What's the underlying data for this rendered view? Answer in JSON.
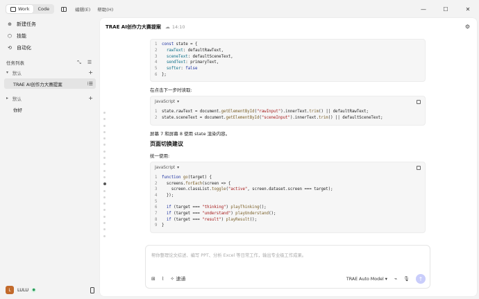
{
  "titlebar": {
    "modes": [
      {
        "label": "Work",
        "active": true
      },
      {
        "label": "Code",
        "active": false
      }
    ],
    "menu": [
      "编辑(E)",
      "帮助(H)"
    ],
    "window_controls": [
      "minimize-icon",
      "maximize-icon",
      "close-icon"
    ]
  },
  "sidebar": {
    "nav": [
      {
        "label": "新建任务",
        "icon": "new-task-icon",
        "glyph": "⊕"
      },
      {
        "label": "技能",
        "icon": "skill-icon",
        "glyph": "⬡"
      },
      {
        "label": "自动化",
        "icon": "automation-icon",
        "glyph": "⟲"
      }
    ],
    "task_list_label": "任务列表",
    "groups": [
      {
        "label": "默认",
        "tasks": [
          {
            "label": "TRAE AI创作力大赛提案",
            "active": true
          }
        ]
      },
      {
        "label": "默认",
        "tasks": [
          {
            "label": "你好",
            "active": false
          }
        ]
      }
    ],
    "user": {
      "name": "LULU",
      "avatar_char": "L"
    }
  },
  "main": {
    "title": "TRAE AI创作力大赛提案",
    "time": "14:10",
    "block1_lines": [
      "const state = {",
      "  rawText: defaultRawText,",
      "  sceneText: defaultSceneText,",
      "  sendText: primaryText,",
      "  softer: false",
      "};"
    ],
    "para1": "在点击下一步时读取:",
    "lang": "JavaScript",
    "block2_lines": [
      "state.rawText = document.getElementById(\"rawInput\").innerText.trim() || defaultRawText;",
      "state.sceneText = document.getElementById(\"sceneInput\").innerText.trim() || defaultSceneText;"
    ],
    "para2": "屏幕 7 和屏幕 8 使用 state 渲染内容。",
    "heading": "页面切换建议",
    "para3": "统一使用:",
    "block3_lines": [
      "function go(target) {",
      "  screens.forEach(screen => {",
      "    screen.classList.toggle(\"active\", screen.dataset.screen === target);",
      "  });",
      "",
      "  if (target === \"thinking\") playThinking();",
      "  if (target === \"understand\") playUnderstand();",
      "  if (target === \"result\") playResult();",
      "}"
    ]
  },
  "composer": {
    "placeholder": "帮你整理论文综述、编写 PPT、分析 Excel 等日常工作，输出专业级工作成果。",
    "speed_label": "速通",
    "model": "TRAE Auto Model"
  }
}
